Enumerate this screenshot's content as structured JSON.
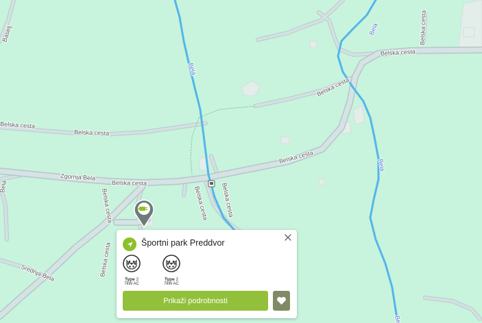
{
  "map": {
    "labels": {
      "baselj": "Baselj",
      "bela_river_top": "Bela",
      "bela_river_mid": "Bela",
      "bela_river_right": "Bela",
      "bela_river_bottom": "Be",
      "belska_cesta_top_right": "Belska cesta",
      "belska_cesta_right_diag": "Belska cesta",
      "belska_cesta_vertical_right": "Belska cesta",
      "belska_cesta_left_top": "Belska cesta",
      "belska_cesta_left_mid": "Belska cesta",
      "belska_cesta_main_right": "Belska cesta",
      "zgornja_bela": "Zgornja Bela",
      "belska_cesta_main_left": "Belska cesta",
      "belska_cesta_vert_a": "Belska cesta",
      "belska_cesta_vert_b": "Belska cesta",
      "belska_cesta_vert_c": "Belska cesta",
      "belska_cesta_vert_d": "Belska cesta",
      "srednja_bela": "Srednja Bela",
      "bela_left_edge": "Bela"
    },
    "colors": {
      "land": "#c8f3dd",
      "road": "#d2dfe0",
      "road_casing": "#bccbcc",
      "river": "#57b8e9",
      "building": "#e2ece8"
    }
  },
  "marker": {
    "icon": "ev-charging-plug-icon",
    "color": "#727c7c",
    "badge_color": "#8dc02a"
  },
  "popup": {
    "title": "Športni park Preddvor",
    "connectors": [
      {
        "type_bold": "Type",
        "type_rest": " 2",
        "power": "7kW AC"
      },
      {
        "type_bold": "Type",
        "type_rest": " 2",
        "power": "7kW AC"
      }
    ],
    "details_label": "Prikaži podrobnosti",
    "accent": "#92c03a",
    "fav_color": "#808a65"
  }
}
